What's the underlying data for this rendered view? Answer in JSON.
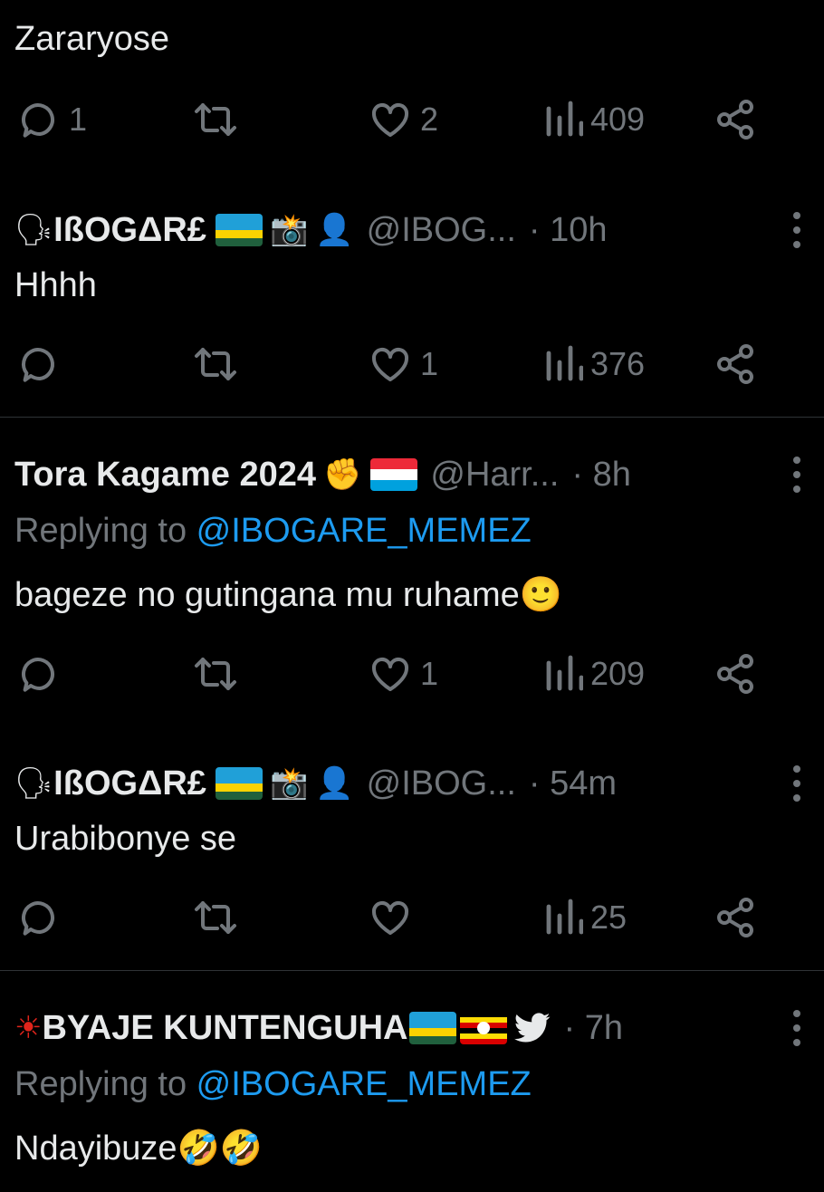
{
  "tweets": [
    {
      "text": "Zararyose",
      "counts": {
        "replies": "1",
        "retweets": "",
        "likes": "2",
        "views": "409"
      }
    },
    {
      "name": "IßOGΔR£",
      "prefix_emoji": "🗣",
      "suffix_emojis": [
        "📸",
        "👤"
      ],
      "flag": "rwanda",
      "handle": "@IBOG...",
      "time": "· 10h",
      "text": "Hhhh",
      "counts": {
        "replies": "",
        "retweets": "",
        "likes": "1",
        "views": "376"
      }
    },
    {
      "name": "Tora Kagame 2024",
      "suffix_emojis": [
        "✊"
      ],
      "flag": "luxembourg",
      "handle": "@Harr...",
      "time": "· 8h",
      "replying_prefix": "Replying to ",
      "replying_to": "@IBOGARE_MEMEZ",
      "text": "bageze no gutingana mu ruhame🙂",
      "counts": {
        "replies": "",
        "retweets": "",
        "likes": "1",
        "views": "209"
      }
    },
    {
      "name": "IßOGΔR£",
      "prefix_emoji": "🗣",
      "suffix_emojis": [
        "📸",
        "👤"
      ],
      "flag": "rwanda",
      "handle": "@IBOG...",
      "time": "· 54m",
      "text": "Urabibonye se",
      "counts": {
        "replies": "",
        "retweets": "",
        "likes": "",
        "views": "25"
      }
    },
    {
      "name": "BYAJE KUNTENGUHA",
      "prefix_emoji": "☀",
      "flags": [
        "rwanda",
        "uganda"
      ],
      "suffix_emojis": [
        "🐦"
      ],
      "time": "· 7h",
      "replying_prefix": "Replying to ",
      "replying_to": "@IBOGARE_MEMEZ",
      "text": "Ndayibuze🤣🤣"
    }
  ],
  "icons": [
    "reply-icon",
    "retweet-icon",
    "like-icon",
    "views-icon",
    "share-icon",
    "more-icon",
    "bird-icon"
  ],
  "colors": {
    "background": "#000000",
    "text": "#e7e9ea",
    "secondary": "#71767b",
    "link": "#1d9bf0",
    "divider": "#2f3336"
  }
}
